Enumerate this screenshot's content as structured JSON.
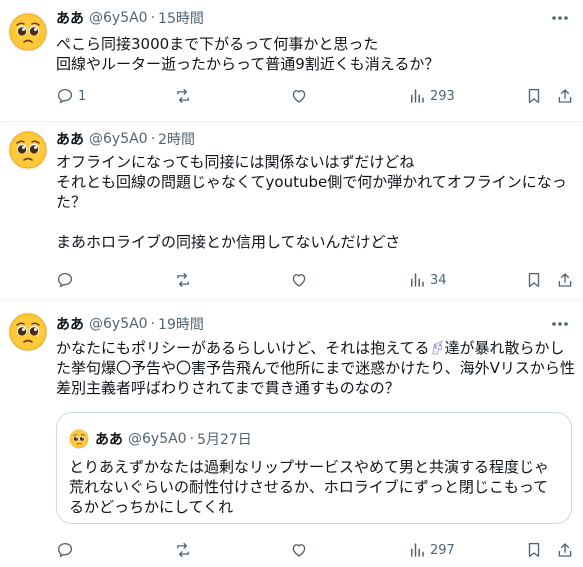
{
  "tweets": [
    {
      "name": "ああ",
      "handle": "@6y5A0",
      "dot": "·",
      "time": "15時間",
      "text": "ぺこら同接3000まで下がるって何事かと思った\n回線やルーター逝ったからって普通9割近くも消えるか？",
      "replies": "1",
      "reposts": "",
      "likes": "",
      "views": "293"
    },
    {
      "name": "ああ",
      "handle": "@6y5A0",
      "dot": "·",
      "time": "2時間",
      "text": "オフラインになっても同接には関係ないはずだけどね\nそれとも回線の問題じゃなくてyoutube側で何か弾かれてオフラインになった？\n\nまあホロライブの同接とか信用してないんだけどさ",
      "replies": "",
      "reposts": "",
      "likes": "",
      "views": "34"
    },
    {
      "name": "ああ",
      "handle": "@6y5A0",
      "dot": "·",
      "time": "19時間",
      "text_before": "かなたにもポリシーがあるらしいけど、それは抱えてる",
      "text_after": "達が暴れ散らかした挙句爆〇予告や〇害予告飛んで他所にまで迷惑かけたり、海外Vリスから性差別主義者呼ばわりされてまで貫き通すものなの？",
      "replies": "",
      "reposts": "",
      "likes": "",
      "views": "297",
      "quote": {
        "name": "ああ",
        "handle": "@6y5A0",
        "dot": "·",
        "date": "5月27日",
        "text": "とりあえずかなたは過剰なリップサービスやめて男と共演する程度じゃ荒れないぐらいの耐性付けさせるか、ホロライブにずっと閉じこもってるかどっちかにしてくれ"
      }
    }
  ],
  "colors": {
    "text": "#0f1419",
    "secondary": "#536471",
    "divider": "#eff3f4",
    "quote_border": "#cfd9de"
  },
  "icons": [
    "pleading-face-emoji",
    "more-icon",
    "reply-icon",
    "repost-icon",
    "like-icon",
    "views-icon",
    "bookmark-icon",
    "share-icon",
    "unicorn-emoji"
  ]
}
